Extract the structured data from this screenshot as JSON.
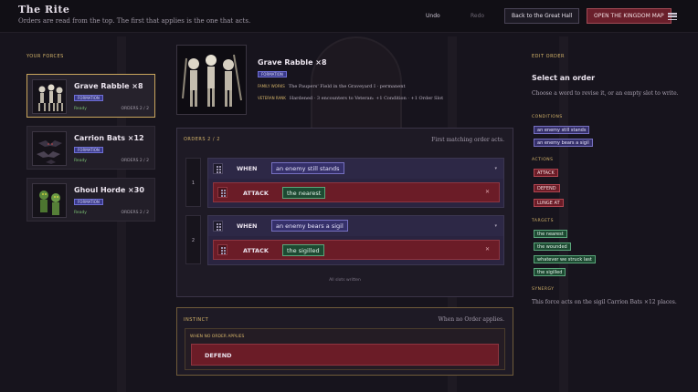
{
  "header": {
    "title": "The Rite",
    "subtitle": "Orders are read from the top. The first that applies is the one that acts.",
    "undo": "Undo",
    "redo": "Redo",
    "back_button": "Back to the Great Hall",
    "map_button": "OPEN THE KINGDOM MAP"
  },
  "sidebar": {
    "label": "YOUR FORCES",
    "forces": [
      {
        "name": "Grave Rabble ×8",
        "badge": "FORMATION",
        "status": "Ready",
        "orders": "ORDERS 2 / 2",
        "active": true
      },
      {
        "name": "Carrion Bats ×12",
        "badge": "FORMATION",
        "status": "Ready",
        "orders": "ORDERS 2 / 2",
        "active": false
      },
      {
        "name": "Ghoul Horde ×30",
        "badge": "FORMATION",
        "status": "Ready",
        "orders": "ORDERS 2 / 2",
        "active": false
      }
    ]
  },
  "unit": {
    "name": "Grave Rabble ×8",
    "badge": "FORMATION",
    "family_label": "FAMILY WORKS",
    "family_value": "The Paupers' Field in the Graveyard I · permanent",
    "veteran_label": "VETERAN RANK",
    "veteran_value": "Hardened · 3 encounters to Veteran: +1 Condition · +1 Order Slot"
  },
  "orders": {
    "label": "ORDERS 2 / 2",
    "note": "First matching order acts.",
    "items": [
      {
        "num": "1",
        "when": "WHEN",
        "condition": "an enemy still stands",
        "action": "ATTACK",
        "target": "the nearest"
      },
      {
        "num": "2",
        "when": "WHEN",
        "condition": "an enemy bears a sigil",
        "action": "ATTACK",
        "target": "the sigilled"
      }
    ],
    "slots_note": "All slots written"
  },
  "instinct": {
    "label": "INSTINCT",
    "note": "When no Order applies.",
    "condition": "WHEN NO ORDER APPLIES",
    "action": "DEFEND"
  },
  "editor": {
    "label": "EDIT ORDER",
    "title": "Select an order",
    "desc": "Choose a word to revise it, or an empty slot to write.",
    "conditions_label": "CONDITIONS",
    "conditions": [
      "an enemy still stands",
      "an enemy bears a sigil"
    ],
    "actions_label": "ACTIONS",
    "actions": [
      "ATTACK",
      "DEFEND",
      "LUNGE AT"
    ],
    "targets_label": "TARGETS",
    "targets": [
      "the nearest",
      "the wounded",
      "whatever we struck last",
      "the sigilled"
    ],
    "synergy_label": "SYNERGY",
    "synergy_text": "This force acts on the sigil Carrion Bats ×12 places."
  },
  "colors": {
    "gold": "#d6b56a",
    "condition": "#35306a",
    "action": "#6b1c27",
    "target": "#1d4a32"
  },
  "icons": [
    "menu-icon",
    "grip-icon",
    "chevron-down-icon",
    "close-icon"
  ]
}
